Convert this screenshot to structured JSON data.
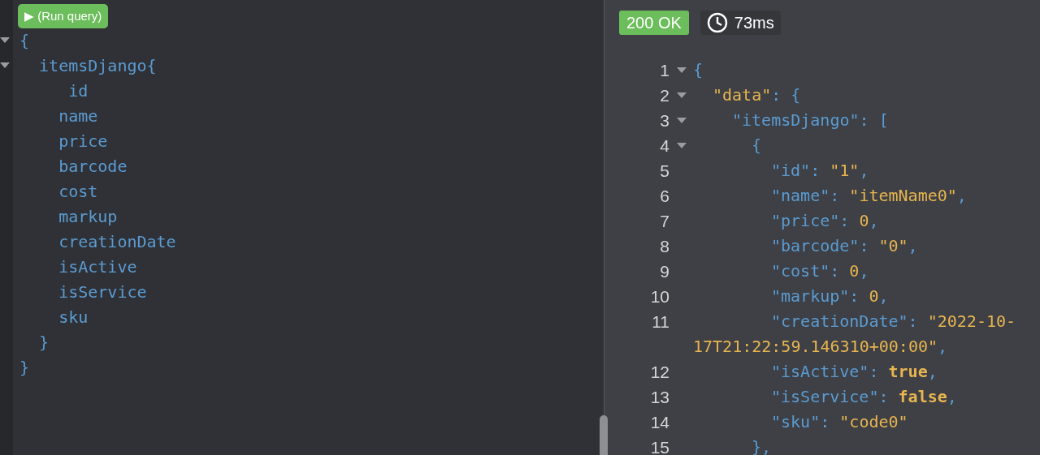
{
  "run_button": {
    "icon": "▶",
    "label": "(Run query)"
  },
  "query": {
    "lines": [
      {
        "text": "{",
        "foldable": true
      },
      {
        "text": "  itemsDjango{",
        "foldable": true
      },
      {
        "text": "     id",
        "foldable": false
      },
      {
        "text": "    name",
        "foldable": false
      },
      {
        "text": "    price",
        "foldable": false
      },
      {
        "text": "    barcode",
        "foldable": false
      },
      {
        "text": "    cost",
        "foldable": false
      },
      {
        "text": "    markup",
        "foldable": false
      },
      {
        "text": "    creationDate",
        "foldable": false
      },
      {
        "text": "    isActive",
        "foldable": false
      },
      {
        "text": "    isService",
        "foldable": false
      },
      {
        "text": "    sku",
        "foldable": false
      },
      {
        "text": "  }",
        "foldable": false
      },
      {
        "text": "}",
        "foldable": false
      }
    ]
  },
  "response": {
    "status": "200 OK",
    "time": "73ms",
    "lines": [
      {
        "number": "1",
        "foldable": true,
        "tokens": [
          {
            "kind": "punct",
            "text": "{"
          }
        ]
      },
      {
        "number": "2",
        "foldable": true,
        "tokens": [
          {
            "kind": "string",
            "text": "\"data\""
          },
          {
            "kind": "punct",
            "text": ": {"
          }
        ]
      },
      {
        "number": "3",
        "foldable": true,
        "tokens": [
          {
            "kind": "key",
            "text": "\"itemsDjango\""
          },
          {
            "kind": "punct",
            "text": ": ["
          }
        ]
      },
      {
        "number": "4",
        "foldable": true,
        "tokens": [
          {
            "kind": "punct",
            "text": "{"
          }
        ]
      },
      {
        "number": "5",
        "foldable": false,
        "tokens": [
          {
            "kind": "key",
            "text": "\"id\""
          },
          {
            "kind": "punct",
            "text": ": "
          },
          {
            "kind": "string",
            "text": "\"1\""
          },
          {
            "kind": "punct",
            "text": ","
          }
        ]
      },
      {
        "number": "6",
        "foldable": false,
        "tokens": [
          {
            "kind": "key",
            "text": "\"name\""
          },
          {
            "kind": "punct",
            "text": ": "
          },
          {
            "kind": "string",
            "text": "\"itemName0\""
          },
          {
            "kind": "punct",
            "text": ","
          }
        ]
      },
      {
        "number": "7",
        "foldable": false,
        "tokens": [
          {
            "kind": "key",
            "text": "\"price\""
          },
          {
            "kind": "punct",
            "text": ": "
          },
          {
            "kind": "number",
            "text": "0"
          },
          {
            "kind": "punct",
            "text": ","
          }
        ]
      },
      {
        "number": "8",
        "foldable": false,
        "tokens": [
          {
            "kind": "key",
            "text": "\"barcode\""
          },
          {
            "kind": "punct",
            "text": ": "
          },
          {
            "kind": "string",
            "text": "\"0\""
          },
          {
            "kind": "punct",
            "text": ","
          }
        ]
      },
      {
        "number": "9",
        "foldable": false,
        "tokens": [
          {
            "kind": "key",
            "text": "\"cost\""
          },
          {
            "kind": "punct",
            "text": ": "
          },
          {
            "kind": "number",
            "text": "0"
          },
          {
            "kind": "punct",
            "text": ","
          }
        ]
      },
      {
        "number": "10",
        "foldable": false,
        "tokens": [
          {
            "kind": "key",
            "text": "\"markup\""
          },
          {
            "kind": "punct",
            "text": ": "
          },
          {
            "kind": "number",
            "text": "0"
          },
          {
            "kind": "punct",
            "text": ","
          }
        ]
      },
      {
        "number": "11",
        "foldable": false,
        "tokens": [
          {
            "kind": "key",
            "text": "\"creationDate\""
          },
          {
            "kind": "punct",
            "text": ": "
          },
          {
            "kind": "string",
            "text": "\"2022-10-"
          }
        ]
      },
      {
        "foldable": false,
        "tokens": [
          {
            "kind": "string",
            "text": "17T21:22:59.146310+00:00\""
          },
          {
            "kind": "punct",
            "text": ","
          }
        ]
      },
      {
        "number": "12",
        "foldable": false,
        "tokens": [
          {
            "kind": "key",
            "text": "\"isActive\""
          },
          {
            "kind": "punct",
            "text": ": "
          },
          {
            "kind": "bool",
            "text": "true"
          },
          {
            "kind": "punct",
            "text": ","
          }
        ]
      },
      {
        "number": "13",
        "foldable": false,
        "tokens": [
          {
            "kind": "key",
            "text": "\"isService\""
          },
          {
            "kind": "punct",
            "text": ": "
          },
          {
            "kind": "bool",
            "text": "false"
          },
          {
            "kind": "punct",
            "text": ","
          }
        ]
      },
      {
        "number": "14",
        "foldable": false,
        "tokens": [
          {
            "kind": "key",
            "text": "\"sku\""
          },
          {
            "kind": "punct",
            "text": ": "
          },
          {
            "kind": "string",
            "text": "\"code0\""
          }
        ]
      },
      {
        "number": "15",
        "foldable": false,
        "tokens": [
          {
            "kind": "punct",
            "text": "},"
          }
        ]
      }
    ]
  }
}
